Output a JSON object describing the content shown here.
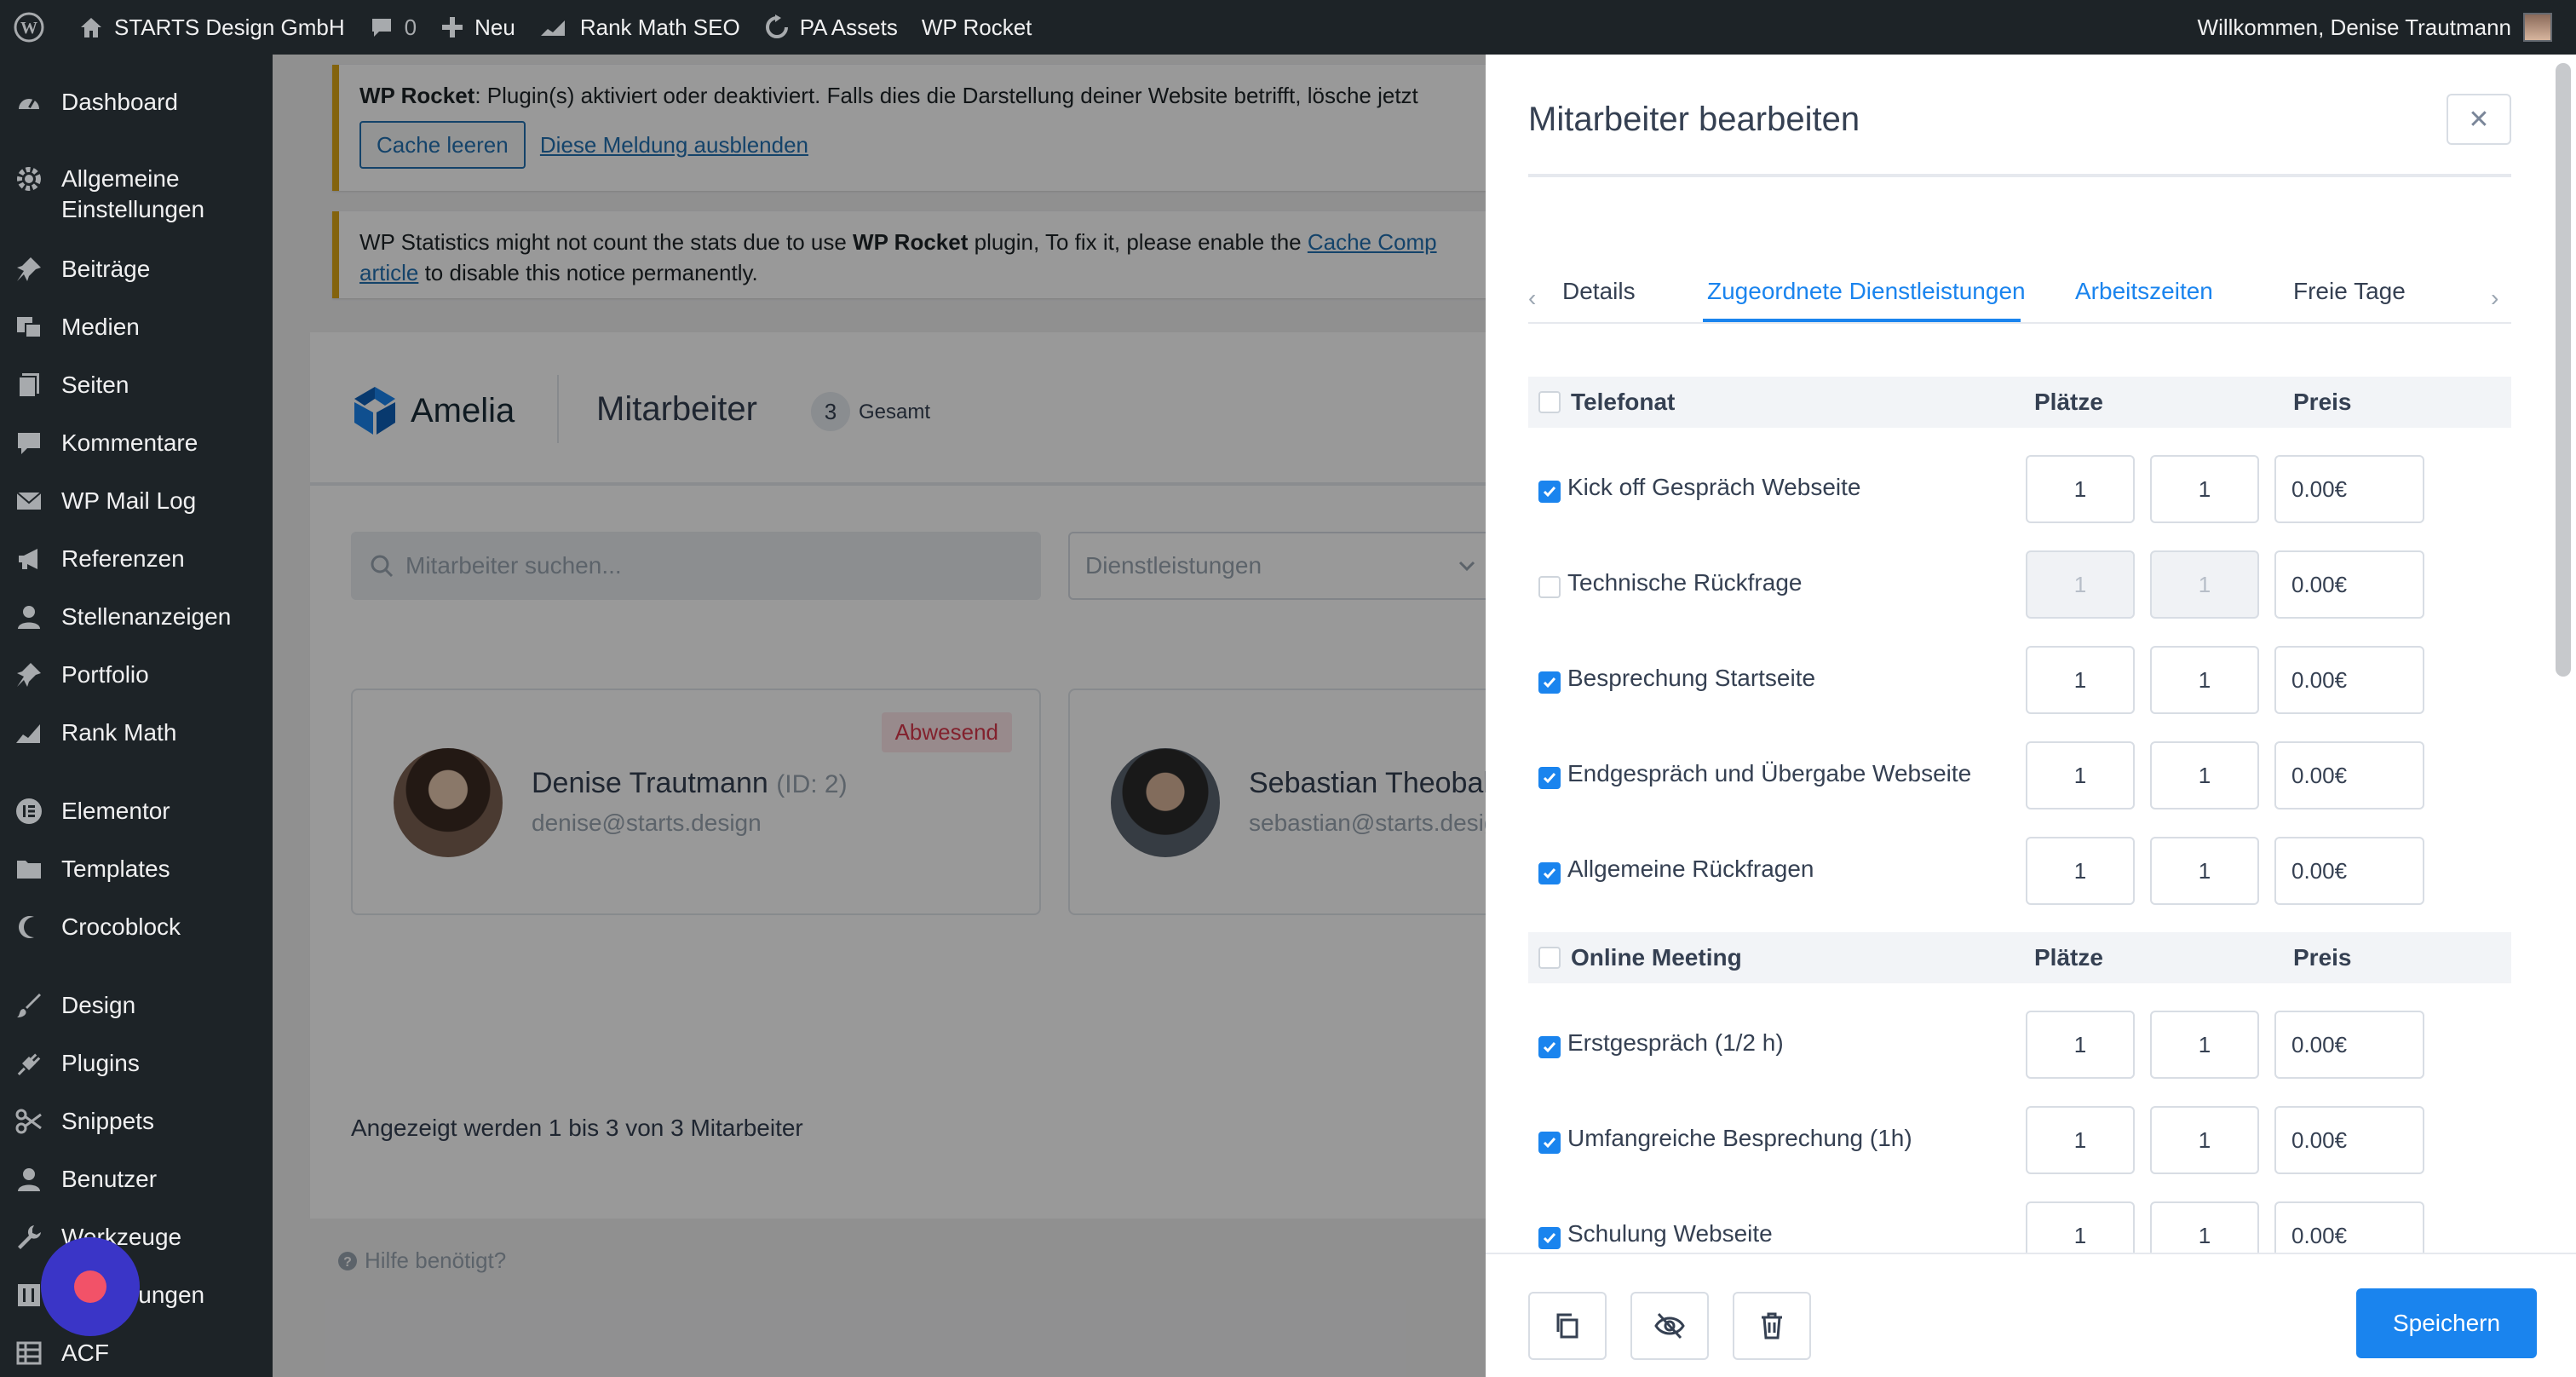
{
  "adminbar": {
    "site_name": "STARTS Design GmbH",
    "comments_count": "0",
    "new_label": "Neu",
    "rankmath_label": "Rank Math SEO",
    "pa_assets_label": "PA Assets",
    "wp_rocket_label": "WP Rocket",
    "welcome": "Willkommen, Denise Trautmann"
  },
  "sidebar": {
    "items": [
      {
        "label": "Dashboard",
        "icon": "dashboard-icon"
      },
      {
        "label": "Allgemeine",
        "label2": "Einstellungen",
        "icon": "gear-icon"
      },
      {
        "label": "Beiträge",
        "icon": "pin-icon"
      },
      {
        "label": "Medien",
        "icon": "media-icon"
      },
      {
        "label": "Seiten",
        "icon": "page-icon"
      },
      {
        "label": "Kommentare",
        "icon": "comment-icon"
      },
      {
        "label": "WP Mail Log",
        "icon": "mail-icon"
      },
      {
        "label": "Referenzen",
        "icon": "megaphone-icon"
      },
      {
        "label": "Stellenanzeigen",
        "icon": "user-icon"
      },
      {
        "label": "Portfolio",
        "icon": "pin-icon"
      },
      {
        "label": "Rank Math",
        "icon": "chart-icon"
      },
      {
        "label": "Elementor",
        "icon": "elementor-icon"
      },
      {
        "label": "Templates",
        "icon": "folder-icon"
      },
      {
        "label": "Crocoblock",
        "icon": "crocoblock-icon"
      },
      {
        "label": "Design",
        "icon": "brush-icon"
      },
      {
        "label": "Plugins",
        "icon": "plugin-icon"
      },
      {
        "label": "Snippets",
        "icon": "scissors-icon"
      },
      {
        "label": "Benutzer",
        "icon": "user-icon"
      },
      {
        "label": "Werkzeuge",
        "icon": "wrench-icon"
      },
      {
        "label": "Einstellungen",
        "icon": "settings-icon"
      },
      {
        "label": "ACF",
        "icon": "grid-icon"
      }
    ]
  },
  "notices": {
    "rocket_bold": "WP Rocket",
    "rocket_text": ": Plugin(s) aktiviert oder deaktiviert. Falls dies die Darstellung deiner Website betrifft, lösche jetzt",
    "cache_button": "Cache leeren",
    "dismiss_link": "Diese Meldung ausblenden",
    "stats_text_1": "WP Statistics might not count the stats due to use ",
    "stats_bold": "WP Rocket",
    "stats_text_2": " plugin, To fix it, please enable the ",
    "stats_link_1": "Cache Comp",
    "stats_link_2": "article",
    "stats_text_3": " to disable this notice permanently."
  },
  "amelia": {
    "logo_text": "Amelia",
    "page_title": "Mitarbeiter",
    "count": "3",
    "total_label": "Gesamt",
    "search_placeholder": "Mitarbeiter suchen...",
    "services_filter": "Dienstleistungen",
    "employees": [
      {
        "name": "Denise Trautmann",
        "id": "(ID: 2)",
        "email": "denise@starts.design",
        "badge": "Abwesend"
      },
      {
        "name": "Sebastian Theobald",
        "id": "",
        "email": "sebastian@starts.desig",
        "badge": ""
      }
    ],
    "pager": "Angezeigt werden 1 bis 3 von 3 Mitarbeiter",
    "help": "Hilfe benötigt?"
  },
  "drawer": {
    "title": "Mitarbeiter bearbeiten",
    "tabs": [
      "Details",
      "Zugeordnete Dienstleistungen",
      "Arbeitszeiten",
      "Freie Tage"
    ],
    "active_tab": "Zugeordnete Dienstleistungen",
    "places_header": "Plätze",
    "price_header": "Preis",
    "groups": [
      {
        "name": "Telefonat",
        "checked": false,
        "services": [
          {
            "name": "Kick off Gespräch Webseite",
            "checked": true,
            "min": "1",
            "max": "1",
            "price": "0.00€"
          },
          {
            "name": "Technische Rückfrage",
            "checked": false,
            "min": "1",
            "max": "1",
            "price": "0.00€"
          },
          {
            "name": "Besprechung Startseite",
            "checked": true,
            "min": "1",
            "max": "1",
            "price": "0.00€"
          },
          {
            "name": "Endgespräch und Übergabe Webseite",
            "checked": true,
            "min": "1",
            "max": "1",
            "price": "0.00€"
          },
          {
            "name": "Allgemeine Rückfragen",
            "checked": true,
            "min": "1",
            "max": "1",
            "price": "0.00€"
          }
        ]
      },
      {
        "name": "Online Meeting",
        "checked": false,
        "services": [
          {
            "name": "Erstgespräch (1/2 h)",
            "checked": true,
            "min": "1",
            "max": "1",
            "price": "0.00€"
          },
          {
            "name": "Umfangreiche Besprechung (1h)",
            "checked": true,
            "min": "1",
            "max": "1",
            "price": "0.00€"
          },
          {
            "name": "Schulung Webseite",
            "checked": true,
            "min": "1",
            "max": "1",
            "price": "0.00€"
          }
        ]
      }
    ],
    "save_label": "Speichern"
  },
  "colors": {
    "admin_dark": "#1d2327",
    "accent_blue": "#1a84ee",
    "notice_yellow": "#dba617",
    "badge_red": "#d9374b"
  }
}
